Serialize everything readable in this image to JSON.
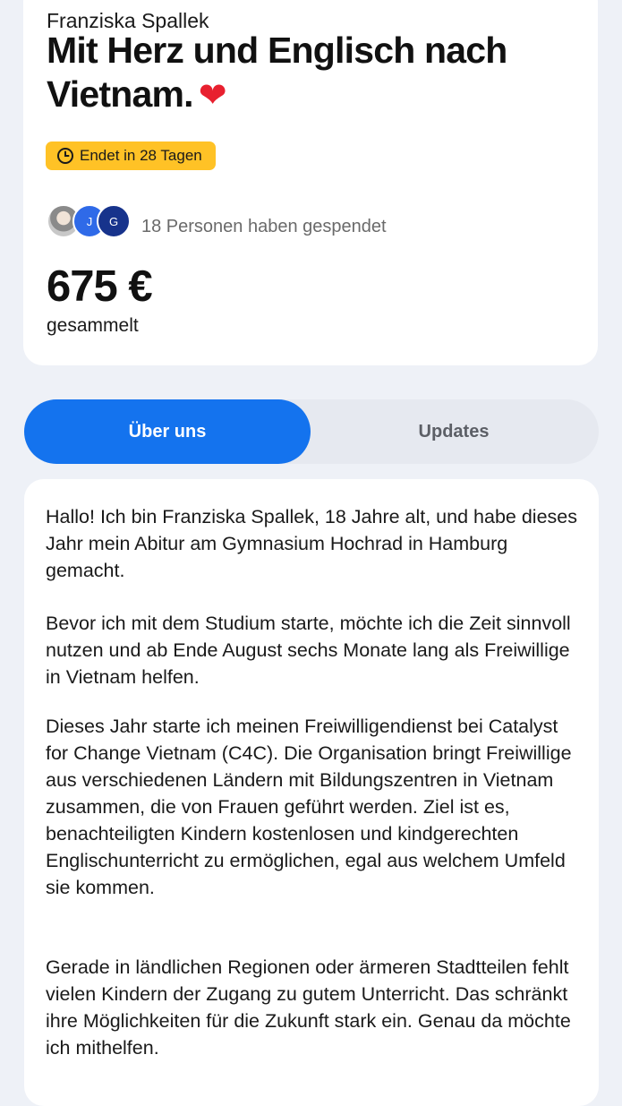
{
  "campaign": {
    "author": "Franziska Spallek",
    "title": "Mit Herz und Englisch nach Vietnam.",
    "title_emoji": "❤",
    "deadline": "Endet in 28 Tagen",
    "donor_avatars": [
      "",
      "J",
      "G"
    ],
    "donors_text": "18 Personen haben gespendet",
    "amount": "675 €",
    "amount_label": "gesammelt"
  },
  "tabs": [
    {
      "label": "Über uns",
      "active": true
    },
    {
      "label": "Updates",
      "active": false
    }
  ],
  "about": {
    "paragraphs": [
      "Hallo! Ich bin Franziska Spallek, 18 Jahre alt, und habe dieses Jahr mein Abitur am Gymnasium Hochrad in Hamburg gemacht.",
      "Bevor ich mit dem Studium starte, möchte ich die Zeit sinnvoll nutzen und ab Ende August sechs Monate lang als Freiwillige in Vietnam helfen.",
      "Dieses Jahr starte ich meinen Freiwilligendienst bei Catalyst for Change Vietnam (C4C). Die Organisation bringt Freiwillige aus verschiedenen Ländern mit Bildungszentren in Vietnam zusammen, die von Frauen geführt werden. Ziel ist es, benachteiligten Kindern kostenlosen und kindgerechten Englischunterricht zu ermöglichen, egal aus welchem Umfeld sie kommen.",
      "Gerade in ländlichen Regionen oder ärmeren Stadtteilen fehlt vielen Kindern der Zugang zu gutem Unterricht. Das schränkt ihre Möglichkeiten für die Zukunft stark ein. Genau da möchte ich mithelfen."
    ]
  },
  "colors": {
    "page_bg": "#eef1f7",
    "accent": "#1473ee",
    "deadline_badge": "#ffc226"
  },
  "icons": {
    "deadline": "clock-icon",
    "title_emoji": "heart-icon"
  }
}
